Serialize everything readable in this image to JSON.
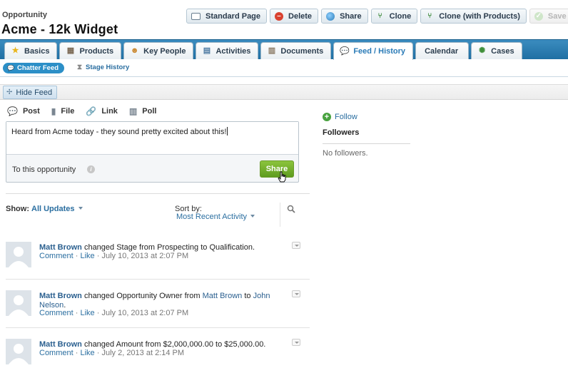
{
  "header": {
    "object_label": "Opportunity",
    "title": "Acme - 12k Widget"
  },
  "actions": [
    {
      "label": "Standard Page",
      "icon": "page-icon"
    },
    {
      "label": "Delete",
      "icon": "delete-icon"
    },
    {
      "label": "Share",
      "icon": "share-globe-icon"
    },
    {
      "label": "Clone",
      "icon": "clone-icon"
    },
    {
      "label": "Clone (with Products)",
      "icon": "clone-products-icon"
    },
    {
      "label": "Save",
      "icon": "save-icon",
      "disabled": true
    }
  ],
  "tabs": [
    {
      "label": "Basics",
      "icon": "star-icon"
    },
    {
      "label": "Products",
      "icon": "products-icon"
    },
    {
      "label": "Key People",
      "icon": "people-icon"
    },
    {
      "label": "Activities",
      "icon": "calendar-list-icon"
    },
    {
      "label": "Documents",
      "icon": "documents-icon"
    },
    {
      "label": "Feed / History",
      "icon": "feed-icon",
      "active": true
    },
    {
      "label": "Calendar",
      "icon": ""
    },
    {
      "label": "Cases",
      "icon": "cases-icon"
    }
  ],
  "subtabs": {
    "chatter": "Chatter Feed",
    "stage_history": "Stage History"
  },
  "toolbar": {
    "hide_feed": "Hide Feed"
  },
  "publisher": {
    "types": [
      "Post",
      "File",
      "Link",
      "Poll"
    ],
    "text": "Heard from Acme today - they sound pretty excited about this!",
    "to_label": "To this opportunity",
    "share_label": "Share"
  },
  "filters": {
    "show_label": "Show:",
    "show_value": "All Updates",
    "sort_label": "Sort by:",
    "sort_value": "Most Recent Activity"
  },
  "feed": [
    {
      "author": "Matt Brown",
      "text": " changed Stage from Prospecting to Qualification.",
      "comment": "Comment",
      "like": "Like",
      "timestamp": "July 10, 2013 at 2:07 PM"
    },
    {
      "author": "Matt Brown",
      "text_a": " changed Opportunity Owner from ",
      "link_a": "Matt Brown",
      "text_b": " to ",
      "link_b": "John Nelson",
      "text_c": ".",
      "comment": "Comment",
      "like": "Like",
      "timestamp": "July 10, 2013 at 2:07 PM"
    },
    {
      "author": "Matt Brown",
      "text": " changed Amount from $2,000,000.00 to $25,000.00.",
      "comment": "Comment",
      "like": "Like",
      "timestamp": "July 2, 2013 at 2:14 PM"
    }
  ],
  "sidebar": {
    "follow": "Follow",
    "followers_title": "Followers",
    "no_followers": "No followers."
  },
  "meta_separator": "·",
  "colors": {
    "tabbar": "#1f6fa3",
    "link": "#2a6ea0",
    "share_green": "#5e9b1e"
  }
}
